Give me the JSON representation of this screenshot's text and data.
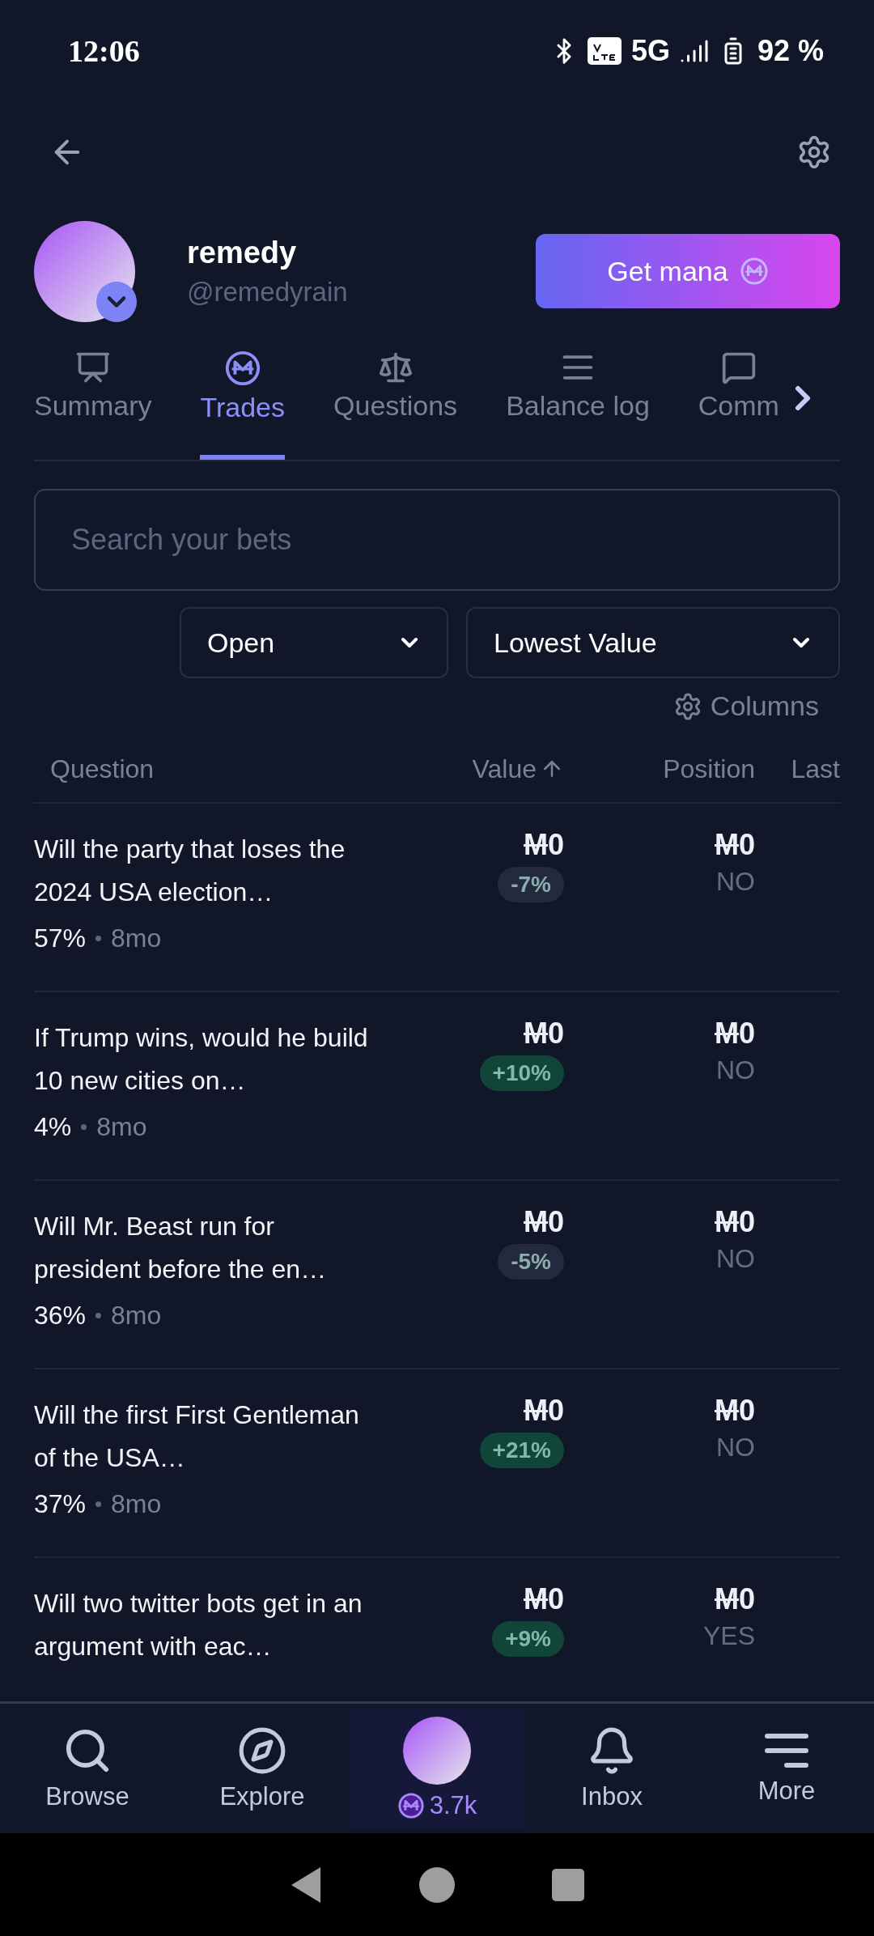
{
  "status_bar": {
    "time": "12:06",
    "network": "5G",
    "battery": "92 %"
  },
  "profile": {
    "name": "remedy",
    "handle": "@remedyrain",
    "button": "Get mana"
  },
  "tabs": [
    {
      "label": "Summary",
      "selected": false
    },
    {
      "label": "Trades",
      "selected": true
    },
    {
      "label": "Questions",
      "selected": false
    },
    {
      "label": "Balance log",
      "selected": false
    },
    {
      "label": "Comm",
      "selected": false
    }
  ],
  "search": {
    "placeholder": "Search your bets"
  },
  "filters": [
    {
      "value": "Open"
    },
    {
      "value": "Lowest Value"
    }
  ],
  "columns_button": "Columns",
  "table": {
    "columns": [
      {
        "label": "Question",
        "sorted": false
      },
      {
        "label": "Value",
        "sorted": true
      },
      {
        "label": "Position",
        "sorted": false
      },
      {
        "label": "Last",
        "sorted": false
      }
    ],
    "rows": [
      {
        "question": "Will the party that loses the 2024 USA election…",
        "probability": "57%",
        "age": "8mo",
        "value": "M0",
        "change": "-7%",
        "color": "#232a3d",
        "position": "M0",
        "outcome": "NO"
      },
      {
        "question": "If Trump wins, would he build 10 new cities on…",
        "probability": "4%",
        "age": "8mo",
        "value": "M0",
        "change": "+10%",
        "color": "#104537",
        "position": "M0",
        "outcome": "NO"
      },
      {
        "question": "Will Mr. Beast run for president before the en…",
        "probability": "36%",
        "age": "8mo",
        "value": "M0",
        "change": "-5%",
        "color": "#232a3d",
        "position": "M0",
        "outcome": "NO"
      },
      {
        "question": "Will the first First Gentleman of the USA…",
        "probability": "37%",
        "age": "8mo",
        "value": "M0",
        "change": "+21%",
        "color": "#104537",
        "position": "M0",
        "outcome": "NO"
      },
      {
        "question": "Will two twitter bots get in an argument with eac…",
        "value": "M0",
        "change": "+9%",
        "color": "#104537",
        "position": "M0",
        "outcome": "YES"
      }
    ]
  },
  "bottom_nav": [
    {
      "label": "Browse",
      "selected": false
    },
    {
      "label": "Explore",
      "selected": false
    },
    {
      "label": "3.7k",
      "selected": true
    },
    {
      "label": "Inbox",
      "selected": false
    },
    {
      "label": "More",
      "selected": false
    }
  ]
}
